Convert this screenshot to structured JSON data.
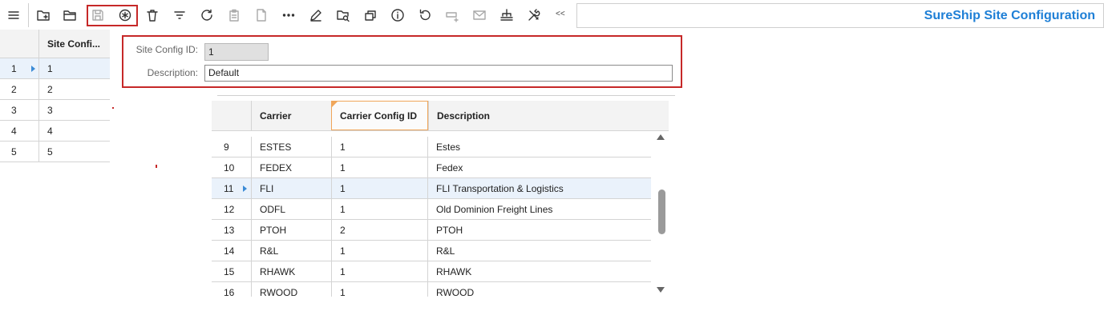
{
  "app": {
    "title": "SureShip Site Configuration"
  },
  "toolbar": {
    "buttons": [
      {
        "name": "menu-icon",
        "enabled": true
      },
      {
        "name": "new-folder-icon",
        "enabled": true
      },
      {
        "name": "open-folder-icon",
        "enabled": true
      },
      {
        "name": "save-icon",
        "enabled": false
      },
      {
        "name": "new-record-icon",
        "enabled": true
      },
      {
        "name": "delete-icon",
        "enabled": true
      },
      {
        "name": "filter-icon",
        "enabled": true
      },
      {
        "name": "refresh-icon",
        "enabled": true
      },
      {
        "name": "clipboard-icon",
        "enabled": false
      },
      {
        "name": "document-icon",
        "enabled": false
      },
      {
        "name": "more-icon",
        "enabled": true
      },
      {
        "name": "edit-icon",
        "enabled": true
      },
      {
        "name": "folder-search-icon",
        "enabled": true
      },
      {
        "name": "copy-icon",
        "enabled": true
      },
      {
        "name": "info-icon",
        "enabled": true
      },
      {
        "name": "undo-icon",
        "enabled": true
      },
      {
        "name": "add-row-icon",
        "enabled": false
      },
      {
        "name": "mail-icon",
        "enabled": false
      },
      {
        "name": "hierarchy-icon",
        "enabled": true
      },
      {
        "name": "tools-icon",
        "enabled": true
      }
    ],
    "collapse_label": "<<"
  },
  "left_grid": {
    "header": "Site Confi...",
    "rows": [
      {
        "index": "1",
        "value": "1",
        "selected": true
      },
      {
        "index": "2",
        "value": "2",
        "selected": false
      },
      {
        "index": "3",
        "value": "3",
        "selected": false
      },
      {
        "index": "4",
        "value": "4",
        "selected": false
      },
      {
        "index": "5",
        "value": "5",
        "selected": false
      }
    ]
  },
  "form": {
    "site_config_id": {
      "label": "Site Config ID:",
      "value": "1"
    },
    "description": {
      "label": "Description:",
      "value": "Default"
    }
  },
  "carrier_grid": {
    "columns": [
      "Carrier",
      "Carrier Config ID",
      "Description"
    ],
    "sorted_column": "Carrier Config ID",
    "rows": [
      {
        "index": "9",
        "carrier": "ESTES",
        "config_id": "1",
        "description": "Estes",
        "selected": false
      },
      {
        "index": "10",
        "carrier": "FEDEX",
        "config_id": "1",
        "description": "Fedex",
        "selected": false
      },
      {
        "index": "11",
        "carrier": "FLI",
        "config_id": "1",
        "description": "FLI Transportation & Logistics",
        "selected": true
      },
      {
        "index": "12",
        "carrier": "ODFL",
        "config_id": "1",
        "description": "Old Dominion Freight Lines",
        "selected": false
      },
      {
        "index": "13",
        "carrier": "PTOH",
        "config_id": "2",
        "description": "PTOH",
        "selected": false
      },
      {
        "index": "14",
        "carrier": "R&L",
        "config_id": "1",
        "description": "R&L",
        "selected": false
      },
      {
        "index": "15",
        "carrier": "RHAWK",
        "config_id": "1",
        "description": "RHAWK",
        "selected": false
      },
      {
        "index": "16",
        "carrier": "RWOOD",
        "config_id": "1",
        "description": "RWOOD",
        "selected": false
      }
    ]
  },
  "colors": {
    "accent": "#1e7fd6",
    "highlight": "#c62828",
    "selected_row": "#eaf2fb"
  }
}
